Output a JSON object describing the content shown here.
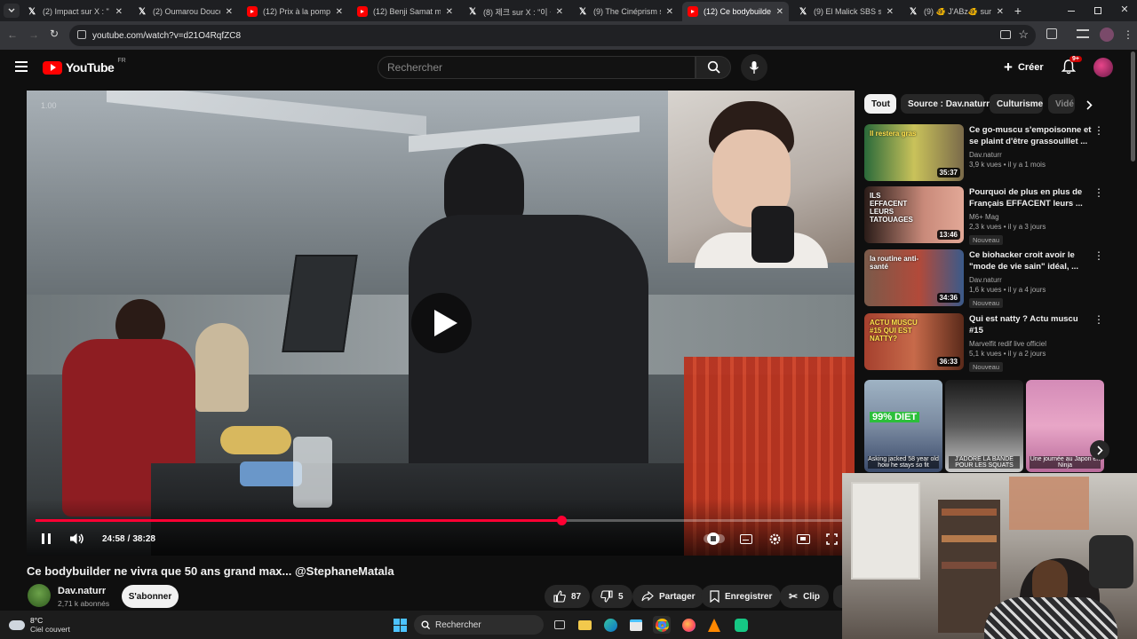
{
  "browser": {
    "tabs": [
      {
        "title": "(2) Impact sur X : \"",
        "icon": "x-icon",
        "active": false
      },
      {
        "title": "(2) Oumarou Doucou",
        "icon": "x-icon",
        "active": false
      },
      {
        "title": "(12) Prix à la pompe",
        "icon": "youtube-icon",
        "active": false
      },
      {
        "title": "(12) Benji Samat m'a",
        "icon": "youtube-icon",
        "active": false
      },
      {
        "title": "(8) 제크 sur X : \"이 등",
        "icon": "x-icon",
        "active": false
      },
      {
        "title": "(9) The Cinéprism sur",
        "icon": "x-icon",
        "active": false
      },
      {
        "title": "(12) Ce bodybuilder",
        "icon": "youtube-icon",
        "active": true
      },
      {
        "title": "(9) El Malick SBS su",
        "icon": "x-icon",
        "active": false
      },
      {
        "title": "(9) 🐠 J'ABz🐠 sur X",
        "icon": "x-icon",
        "active": false
      }
    ],
    "url": "youtube.com/watch?v=d21O4RqfZC8"
  },
  "youtube": {
    "logo_text": "YouTube",
    "region": "FR",
    "search_placeholder": "Rechercher",
    "create_label": "Créer",
    "notif_count": "9+"
  },
  "player": {
    "time_current": "24:58",
    "time_separator": "/",
    "time_total": "38:28",
    "progress": 0.649,
    "playback_speed_overlay": "1.00"
  },
  "video": {
    "title": "Ce bodybuilder ne vivra que 50 ans grand max... @StephaneMatala",
    "channel": "Dav.naturr",
    "subscribers": "2,71 k abonnés",
    "subscribe_label": "S'abonner",
    "likes": "87",
    "dislikes": "5",
    "share_label": "Partager",
    "save_label": "Enregistrer",
    "clip_label": "Clip"
  },
  "chips": [
    "Tout",
    "Source : Dav.naturr",
    "Culturisme",
    "Vidé"
  ],
  "recommendations": [
    {
      "title": "Ce go-muscu s'empoisonne et se plaint d'être grassouillet ...",
      "channel": "Dav.naturr",
      "meta": "3,9 k vues • il y a 1 mois",
      "duration": "35:37",
      "badge": "",
      "thumb_text": "Il restera gras"
    },
    {
      "title": "Pourquoi de plus en plus de Français EFFACENT leurs ...",
      "channel": "M6+ Mag",
      "meta": "2,3 k vues • il y a 3 jours",
      "duration": "13:46",
      "badge": "Nouveau",
      "thumb_text": "ILS EFFACENT LEURS TATOUAGES"
    },
    {
      "title": "Ce biohacker croit avoir le \"mode de vie sain\" idéal, ...",
      "channel": "Dav.naturr",
      "meta": "1,6 k vues • il y a 4 jours",
      "duration": "34:36",
      "badge": "Nouveau",
      "thumb_text": "la routine anti-santé"
    },
    {
      "title": "Qui est natty ? Actu muscu #15",
      "channel": "Marvelfit redif live officiel",
      "meta": "5,1 k vues • il y a 2 jours",
      "duration": "36:33",
      "badge": "Nouveau",
      "thumb_text": "ACTU MUSCU #15 QUI EST NATTY?"
    }
  ],
  "shorts": [
    {
      "caption": "Asking jacked 58 year old how he stays so fit",
      "overlay": "99% DIET"
    },
    {
      "caption": "J'ADORE LA BANDE POUR LES SQUATS",
      "overlay": ""
    },
    {
      "caption": "Une journée au Japon en Ninja",
      "overlay": ""
    }
  ],
  "taskbar": {
    "weather_temp": "8°C",
    "weather_desc": "Ciel couvert",
    "search_label": "Rechercher"
  },
  "colors": {
    "accent": "#ff0033",
    "youtube_red": "#ff0000",
    "background": "#0f0f0f"
  }
}
